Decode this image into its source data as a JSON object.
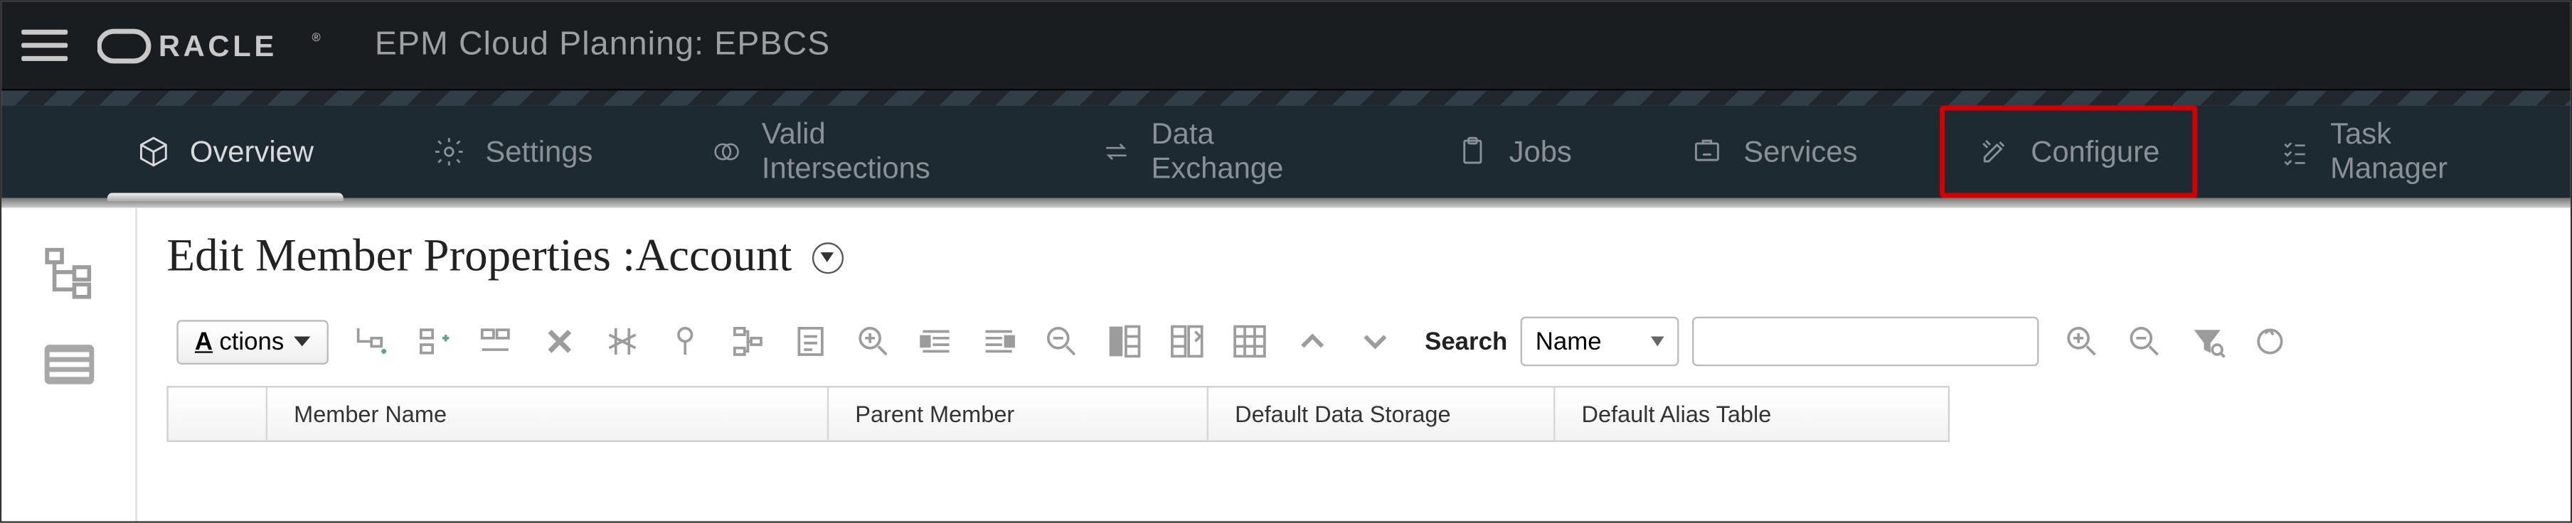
{
  "app": {
    "brand": "ORACLE",
    "title": "EPM Cloud Planning: EPBCS"
  },
  "nav": {
    "items": [
      {
        "label": "Overview",
        "icon": "cube",
        "active": true
      },
      {
        "label": "Settings",
        "icon": "gear"
      },
      {
        "label": "Valid Intersections",
        "icon": "intersection"
      },
      {
        "label": "Data Exchange",
        "icon": "exchange"
      },
      {
        "label": "Jobs",
        "icon": "clipboard"
      },
      {
        "label": "Services",
        "icon": "services"
      },
      {
        "label": "Configure",
        "icon": "tools",
        "highlight": true
      },
      {
        "label": "Task Manager",
        "icon": "tasks"
      }
    ]
  },
  "page": {
    "title": "Edit Member Properties :Account"
  },
  "toolbar": {
    "actions_label": "ctions",
    "actions_prefix": "A",
    "search_label": "Search",
    "search_type": "Name",
    "search_value": "",
    "icons": [
      "add-child",
      "add-sibling",
      "rename",
      "delete",
      "cut",
      "lock",
      "show-ancestors",
      "show-usage",
      "zoom-in",
      "collapse-level",
      "expand-level",
      "zoom-out",
      "freeze",
      "unfreeze-columns",
      "table-settings",
      "move-up",
      "move-down"
    ],
    "right_icons": [
      "search-zoom-in",
      "search-zoom-out",
      "filter-search",
      "refresh"
    ]
  },
  "grid": {
    "columns": [
      "Member Name",
      "Parent Member",
      "Default Data Storage",
      "Default Alias Table"
    ],
    "widths": [
      340,
      230,
      210,
      220
    ]
  }
}
